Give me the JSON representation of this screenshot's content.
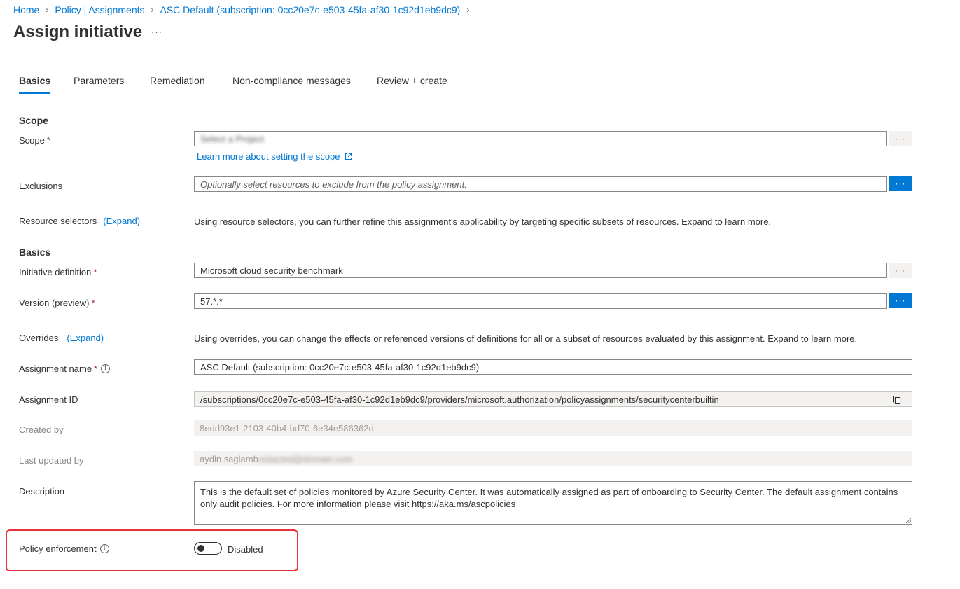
{
  "breadcrumb": {
    "items": [
      "Home",
      "Policy | Assignments",
      "ASC Default (subscription: 0cc20e7c-e503-45fa-af30-1c92d1eb9dc9)"
    ],
    "separator": ">"
  },
  "page": {
    "title": "Assign initiative",
    "more": "···"
  },
  "tabs": [
    {
      "label": "Basics",
      "active": true
    },
    {
      "label": "Parameters"
    },
    {
      "label": "Remediation"
    },
    {
      "label": "Non-compliance messages"
    },
    {
      "label": "Review + create"
    }
  ],
  "sections": {
    "scope": "Scope",
    "basics": "Basics"
  },
  "scope": {
    "label": "Scope",
    "required": "*",
    "value": "Select a Project",
    "learn_more": "Learn more about setting the scope",
    "button": "···"
  },
  "exclusions": {
    "label": "Exclusions",
    "placeholder": "Optionally select resources to exclude from the policy assignment.",
    "button": "···"
  },
  "resource_selectors": {
    "label": "Resource selectors",
    "expand": "(Expand)",
    "description": "Using resource selectors, you can further refine this assignment's applicability by targeting specific subsets of resources. Expand to learn more."
  },
  "initiative_definition": {
    "label": "Initiative definition",
    "required": "*",
    "value": "Microsoft cloud security benchmark",
    "button": "···"
  },
  "version": {
    "label": "Version (preview)",
    "required": "*",
    "value": "57.*.*",
    "button": "···"
  },
  "overrides": {
    "label": "Overrides",
    "expand": "(Expand)",
    "description": "Using overrides, you can change the effects or referenced versions of definitions for all or a subset of resources evaluated by this assignment. Expand to learn more."
  },
  "assignment_name": {
    "label": "Assignment name",
    "required": "*",
    "value": "ASC Default (subscription: 0cc20e7c-e503-45fa-af30-1c92d1eb9dc9)"
  },
  "assignment_id": {
    "label": "Assignment ID",
    "value": "/subscriptions/0cc20e7c-e503-45fa-af30-1c92d1eb9dc9/providers/microsoft.authorization/policyassignments/securitycenterbuiltin"
  },
  "created_by": {
    "label": "Created by",
    "value": "8edd93e1-2103-40b4-bd70-6e34e586362d"
  },
  "last_updated_by": {
    "label": "Last updated by",
    "value": "aydin.saglamb",
    "value_hidden": "redacted@domain.com"
  },
  "description": {
    "label": "Description",
    "lines": [
      "This is the default set of policies monitored by Azure Security Center. It was automatically assigned as part of onboarding to Security Center. The default assignment contains",
      "only audit policies. For more information please visit https://aka.ms/ascpolicies"
    ]
  },
  "policy_enforcement": {
    "label": "Policy enforcement",
    "state": "Disabled",
    "enabled": false
  },
  "colors": {
    "accent": "#0078d4",
    "highlight": "#e8333a",
    "required": "#a4262c"
  }
}
